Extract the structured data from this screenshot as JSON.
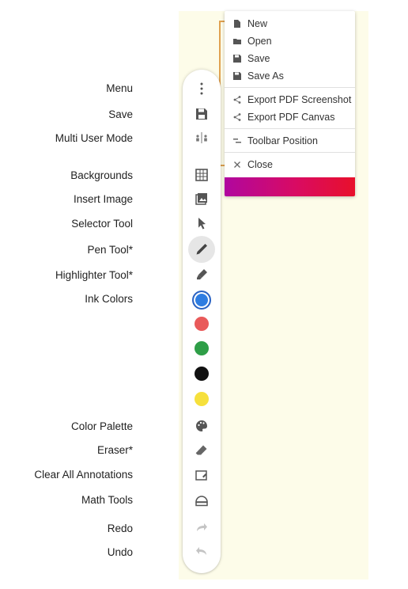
{
  "labels": {
    "menu": "Menu",
    "save": "Save",
    "multi_user": "Multi User Mode",
    "backgrounds": "Backgrounds",
    "insert_image": "Insert Image",
    "selector": "Selector Tool",
    "pen": "Pen Tool*",
    "highlighter": "Highlighter Tool*",
    "ink_colors": "Ink Colors",
    "color_palette": "Color Palette",
    "eraser": "Eraser*",
    "clear_all": "Clear All Annotations",
    "math_tools": "Math Tools",
    "redo": "Redo",
    "undo": "Undo"
  },
  "menu": {
    "new": "New",
    "open": "Open",
    "save": "Save",
    "save_as": "Save As",
    "export_screenshot": "Export PDF Screenshot",
    "export_canvas": "Export PDF Canvas",
    "toolbar_position": "Toolbar Position",
    "close": "Close"
  },
  "ink_colors": [
    "#2f7de1",
    "#e95a5a",
    "#2e9e47",
    "#111111",
    "#f6e03c"
  ],
  "colors": {
    "canvas": "#fdfce9",
    "bracket": "#e0a150",
    "icon": "#555555",
    "icon_disabled": "#bdbdbd"
  },
  "icons": {
    "menu": "kebab-icon",
    "save": "floppy-icon",
    "multi_user": "split-users-icon",
    "backgrounds": "grid-icon",
    "insert_image": "image-icon",
    "selector": "cursor-icon",
    "pen": "pen-icon",
    "highlighter": "highlighter-icon",
    "color_palette": "palette-icon",
    "eraser": "eraser-icon",
    "clear_all": "clear-icon",
    "math_tools": "ruler-icon",
    "redo": "redo-icon",
    "undo": "undo-icon"
  }
}
